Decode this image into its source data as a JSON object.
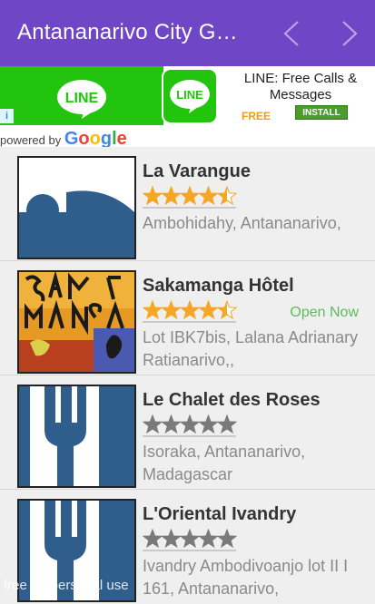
{
  "appbar": {
    "title": "Antananarivo City G…",
    "color": "#6f46c6"
  },
  "ad": {
    "brand": "LINE",
    "title": "LINE: Free Calls & Messages",
    "free_label": "FREE",
    "install_label": "INSTALL",
    "info_label": "i",
    "powered_by": "powered by",
    "google": "Google"
  },
  "places": [
    {
      "name": "La Varangue",
      "rating": 4.5,
      "address": "Ambohidahy, Antananarivo,",
      "status": "",
      "thumb": "generic-photo-icon"
    },
    {
      "name": "Sakamanga Hôtel",
      "rating": 4.5,
      "address": "Lot IBK7bis, Lalana Adrianary Ratianarivo,,",
      "status": "Open Now",
      "thumb": "sakamanga-logo"
    },
    {
      "name": "Le Chalet des Roses",
      "rating": 0,
      "address": "Isoraka, Antananarivo, Madagascar",
      "status": "",
      "thumb": "fork-icon"
    },
    {
      "name": "L'Oriental Ivandry",
      "rating": 0,
      "address": "Ivandry Ambodivoanjo lot II I 161, Antananarivo,",
      "status": "",
      "thumb": "fork-icon"
    }
  ],
  "watermark": "free for personal use"
}
